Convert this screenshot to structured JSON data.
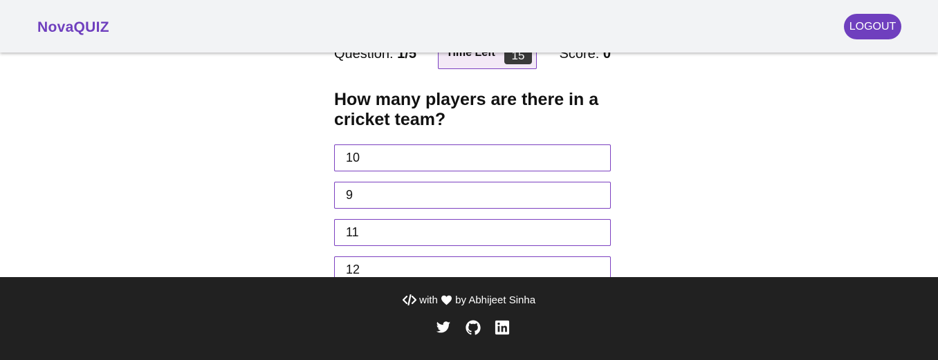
{
  "header": {
    "logo": "NovaQUIZ",
    "logout_label": "LOGOUT"
  },
  "stats": {
    "question_label": "Question: ",
    "question_value": "1/5",
    "time_label": "Time Left",
    "time_value": "15",
    "score_label": "Score: ",
    "score_value": "0"
  },
  "question": {
    "text": "How many players are there in a cricket team?",
    "options": [
      "10",
      "9",
      "11",
      "12"
    ]
  },
  "footer": {
    "with": "with",
    "by": "by Abhijeet Sinha",
    "icons": [
      "code-icon",
      "heart-icon",
      "twitter-icon",
      "github-icon",
      "linkedin-icon"
    ]
  },
  "colors": {
    "accent": "#6f3fbe",
    "footer_bg": "#212121",
    "header_bg": "#f2f3f5"
  }
}
